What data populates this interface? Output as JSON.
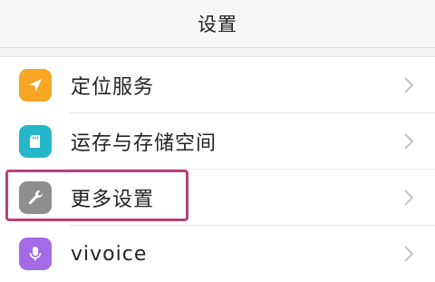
{
  "header": {
    "title": "设置"
  },
  "items": [
    {
      "label": "定位服务",
      "icon": "location-arrow-icon",
      "color": "#f6a623"
    },
    {
      "label": "运存与存储空间",
      "icon": "sd-card-icon",
      "color": "#26b6c9"
    },
    {
      "label": "更多设置",
      "icon": "wrench-icon",
      "color": "#8e8e8e"
    },
    {
      "label": "vivoice",
      "icon": "microphone-icon",
      "color": "#a46be6"
    }
  ],
  "accent": {
    "highlight_border": "#b9407c"
  }
}
